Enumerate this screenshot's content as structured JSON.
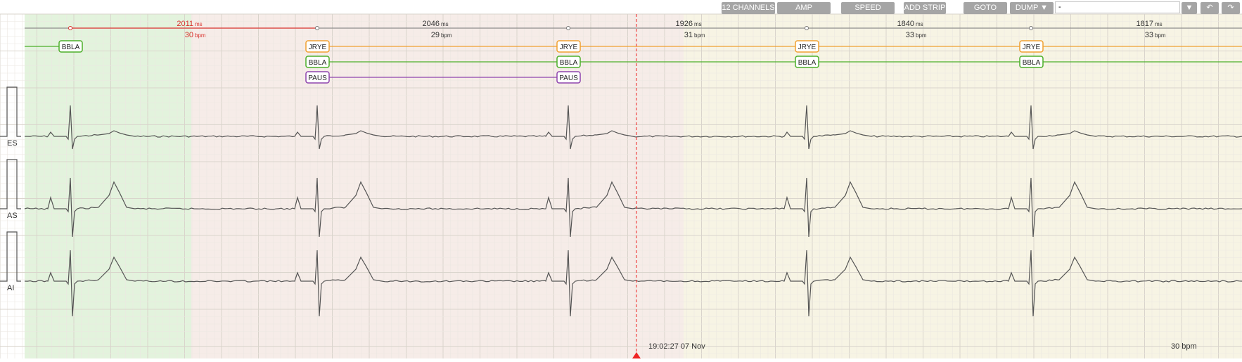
{
  "toolbar": {
    "channels_label": "12 CHANNELS",
    "amp_label": "AMP",
    "speed_label": "SPEED",
    "add_strip_label": "ADD STRIP",
    "goto_label": "GOTO",
    "dump_label": "DUMP ▼",
    "dump_value": "-",
    "dropdown_icon": "caret-down-icon",
    "undo_icon": "undo-icon",
    "redo_icon": "redo-icon"
  },
  "intervals": [
    {
      "ms": "2011",
      "unit_ms": "ms",
      "bpm": "30",
      "unit_bpm": "bpm",
      "highlight": true
    },
    {
      "ms": "2046",
      "unit_ms": "ms",
      "bpm": "29",
      "unit_bpm": "bpm",
      "highlight": false
    },
    {
      "ms": "1926",
      "unit_ms": "ms",
      "bpm": "31",
      "unit_bpm": "bpm",
      "highlight": false
    },
    {
      "ms": "1840",
      "unit_ms": "ms",
      "bpm": "33",
      "unit_bpm": "bpm",
      "highlight": false
    },
    {
      "ms": "1817",
      "unit_ms": "ms",
      "bpm": "33",
      "unit_bpm": "bpm",
      "highlight": false
    }
  ],
  "labels": [
    {
      "text": "BBLA",
      "row": 0,
      "beat": 0,
      "color": "#4caf2a"
    },
    {
      "text": "JRYE",
      "row": 0,
      "beat": 1,
      "color": "#f0a030"
    },
    {
      "text": "BBLA",
      "row": 1,
      "beat": 1,
      "color": "#4caf2a"
    },
    {
      "text": "PAUS",
      "row": 2,
      "beat": 1,
      "color": "#8e44ad"
    },
    {
      "text": "JRYE",
      "row": 0,
      "beat": 2,
      "color": "#f0a030"
    },
    {
      "text": "BBLA",
      "row": 1,
      "beat": 2,
      "color": "#4caf2a"
    },
    {
      "text": "PAUS",
      "row": 2,
      "beat": 2,
      "color": "#8e44ad"
    },
    {
      "text": "JRYE",
      "row": 0,
      "beat": 3,
      "color": "#f0a030"
    },
    {
      "text": "BBLA",
      "row": 1,
      "beat": 3,
      "color": "#4caf2a"
    },
    {
      "text": "JRYE",
      "row": 0,
      "beat": 4,
      "color": "#f0a030"
    },
    {
      "text": "BBLA",
      "row": 1,
      "beat": 4,
      "color": "#4caf2a"
    }
  ],
  "channels": [
    "ES",
    "AS",
    "AI"
  ],
  "cursor_time": "19:02:27 07 Nov",
  "rate": "30 bpm",
  "colors": {
    "green_zone": "#e3f3dd",
    "pink_zone": "#f6ece8",
    "yellow_zone": "#f7f4e4",
    "cursor": "#e22",
    "interval_red": "#d9302c",
    "trace": "#555555"
  }
}
